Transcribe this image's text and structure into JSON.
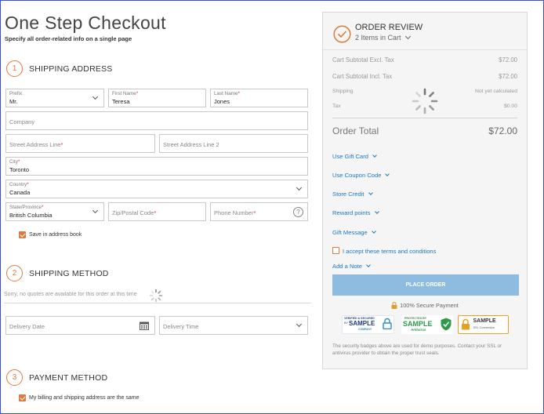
{
  "page": {
    "title": "One Step Checkout",
    "subtitle": "Specify all order-related info on a single page"
  },
  "shipping_address": {
    "step_number": "1",
    "title": "SHIPPING ADDRESS",
    "prefix": {
      "label": "Prefix",
      "value": "Mr."
    },
    "first_name": {
      "label": "First Name",
      "required": "*",
      "value": "Teresa"
    },
    "last_name": {
      "label": "Last Name",
      "required": "*",
      "value": "Jones"
    },
    "company": {
      "placeholder": "Company"
    },
    "street1": {
      "placeholder": "Street Address Line",
      "required": "*"
    },
    "street2": {
      "placeholder": "Street Address Line 2"
    },
    "city": {
      "label": "City",
      "required": "*",
      "value": "Toronto"
    },
    "country": {
      "label": "Country",
      "required": "*",
      "value": "Canada"
    },
    "state": {
      "label": "State/Province",
      "required": "*",
      "value": "British Columbia"
    },
    "zip": {
      "placeholder": "Zip/Postal Code",
      "required": "*"
    },
    "phone": {
      "placeholder": "Phone Number",
      "required": "*",
      "help_glyph": "?"
    },
    "save_in_address_book": "Save in address book"
  },
  "shipping_method": {
    "step_number": "2",
    "title": "SHIPPING METHOD",
    "no_quotes": "Sorry, no quotes are available for this order at this time",
    "delivery_date": {
      "placeholder": "Delivery Date"
    },
    "delivery_time": {
      "placeholder": "Delivery Time"
    }
  },
  "payment_method": {
    "step_number": "3",
    "title": "PAYMENT METHOD",
    "same_address": "My billing and shipping address are the same"
  },
  "order_review": {
    "title": "ORDER REVIEW",
    "items_count": "2 Items in Cart",
    "rows": [
      {
        "label": "Cart Subtotal Excl. Tax",
        "value": "$72.00"
      },
      {
        "label": "Cart Subtotal Incl. Tax",
        "value": "$72.00"
      },
      {
        "label": "Shipping",
        "value": "Not yet calculated"
      },
      {
        "label": "Tax",
        "value": "$0.00"
      }
    ],
    "total": {
      "label": "Order Total",
      "value": "$72.00"
    },
    "links": [
      "Use Gift Card",
      "Use Coupon Code",
      "Store Credit",
      "Reward points",
      "Gift Message"
    ],
    "terms": "I accept these terms and conditions",
    "add_note": "Add a Note",
    "place_order": "PLACE ORDER",
    "secure": "100% Secure Payment",
    "badges": {
      "b1_top": "VERIFIED & SECURED",
      "b1_by": "BY",
      "b1_main": "SAMPLE",
      "b1_sub": "COMPANY",
      "b2_top": "PROTECTED BY",
      "b2_main": "SAMPLE",
      "b2_sub": "Antivirus",
      "b3_main": "SAMPLE",
      "b3_sub": "SSL Connection"
    },
    "disclaimer": "The security badges above are used for demo purposes. Contact your SSL or antivirus provider to obtain the proper trust seals."
  },
  "colors": {
    "accent": "#e07a3a",
    "link": "#1979c3",
    "button": "#8ebce0",
    "frame": "#3a4fd6"
  }
}
